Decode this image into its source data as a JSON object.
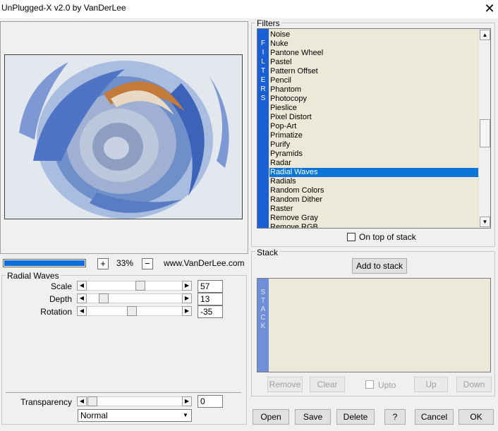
{
  "window": {
    "title": "UnPlugged-X v2.0 by VanDerLee",
    "close_glyph": "✕"
  },
  "preview": {
    "progress": 1.0,
    "zoom_minus": "−",
    "zoom_plus": "+",
    "zoom": "33%",
    "url": "www.VanDerLee.com"
  },
  "params": {
    "group_title": "Radial Waves",
    "sliders": [
      {
        "label": "Scale",
        "value": "57",
        "fraction": 0.57
      },
      {
        "label": "Depth",
        "value": "13",
        "fraction": 0.13
      },
      {
        "label": "Rotation",
        "value": "-35",
        "fraction": 0.465
      }
    ],
    "transparency": {
      "label": "Transparency",
      "value": "0",
      "fraction": 0.0
    },
    "blend_mode": "Normal"
  },
  "filters": {
    "group_title": "Filters",
    "strip_letters": [
      "F",
      "I",
      "L",
      "T",
      "E",
      "R",
      "S"
    ],
    "items": [
      "Noise",
      "Nuke",
      "Pantone Wheel",
      "Pastel",
      "Pattern Offset",
      "Pencil",
      "Phantom",
      "Photocopy",
      "Pieslice",
      "Pixel Distort",
      "Pop-Art",
      "Primatize",
      "Purify",
      "Pyramids",
      "Radar",
      "Radial Waves",
      "Radials",
      "Random Colors",
      "Random Dither",
      "Raster",
      "Remove Gray",
      "Remove RGB"
    ],
    "selected": "Radial Waves",
    "on_top_label": "On top of stack"
  },
  "stack": {
    "group_title": "Stack",
    "add_label": "Add to stack",
    "strip_letters": [
      "S",
      "T",
      "A",
      "C",
      "K"
    ],
    "remove_label": "Remove",
    "clear_label": "Clear",
    "upto_label": "Upto",
    "up_label": "Up",
    "down_label": "Down"
  },
  "footer": {
    "open": "Open",
    "save": "Save",
    "delete": "Delete",
    "help": "?",
    "cancel": "Cancel",
    "ok": "OK"
  },
  "colors": {
    "accent": "#0a74d8",
    "filters_strip": "#1a5fd6",
    "stack_strip": "#6f8fd8",
    "list_bg": "#ece9d8"
  },
  "icons": {
    "left": "◀",
    "right": "▶",
    "up": "▲",
    "down": "▼"
  }
}
